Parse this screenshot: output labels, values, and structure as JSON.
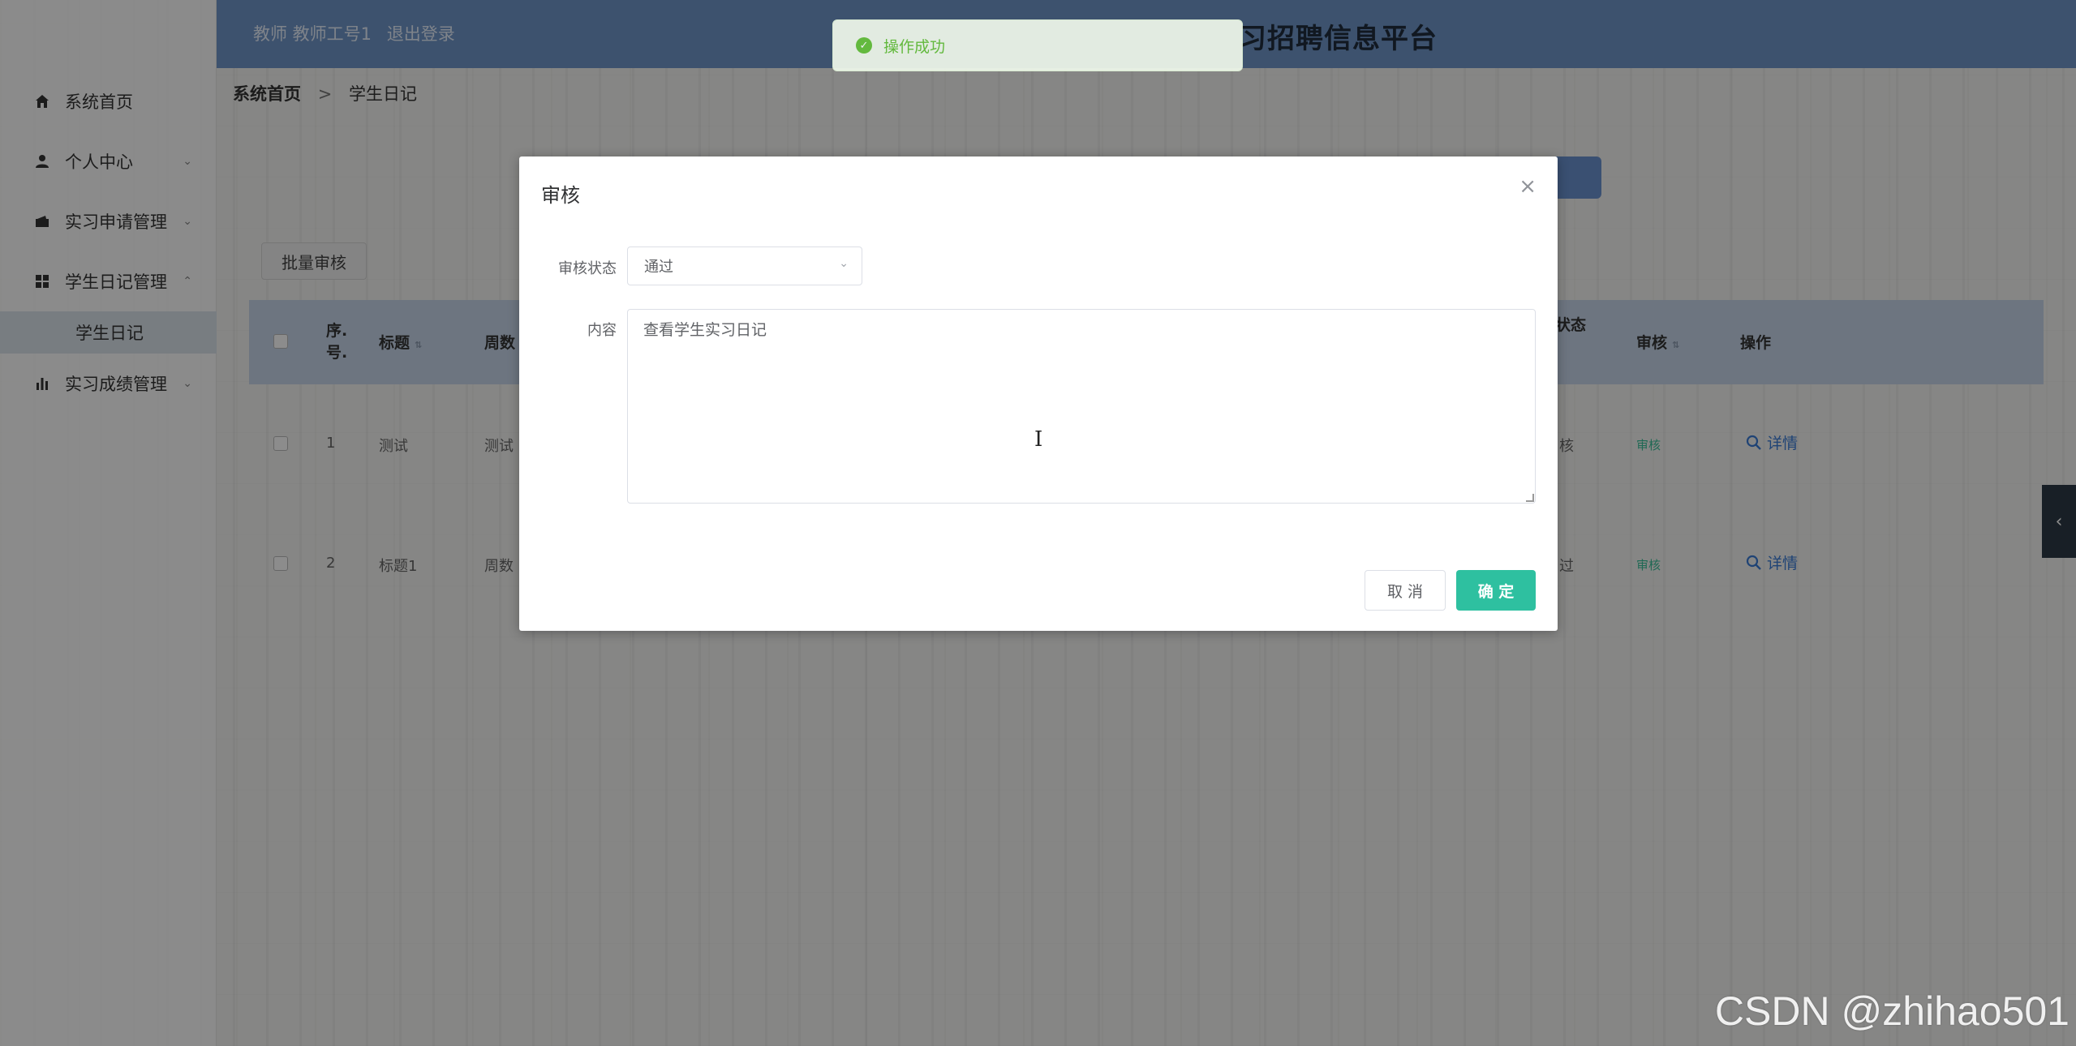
{
  "header": {
    "user_text": "教师 教师工号1",
    "logout_label": "退出登录",
    "site_title": "习招聘信息平台"
  },
  "sidebar": {
    "items": [
      {
        "label": "系统首页",
        "icon": "home-icon"
      },
      {
        "label": "个人中心",
        "icon": "user-icon"
      },
      {
        "label": "实习申请管理",
        "icon": "wallet-icon"
      },
      {
        "label": "学生日记管理",
        "icon": "grid-icon"
      },
      {
        "label": "实习成绩管理",
        "icon": "bar-chart-icon"
      }
    ],
    "sub_items": [
      {
        "label": "学生日记"
      }
    ]
  },
  "breadcrumb": {
    "home": "系统首页",
    "separator": ">",
    "current": "学生日记"
  },
  "toolbar": {
    "batch_review_label": "批量审核"
  },
  "table": {
    "headers": {
      "index": "序.\n号.",
      "title": "标题",
      "week": "周数",
      "review_status": "状态",
      "review": "审核",
      "actions": "操作"
    },
    "rows": [
      {
        "index": "1",
        "title": "测试",
        "week": "测试",
        "review_status": "核",
        "review": "审核",
        "action": "详情"
      },
      {
        "index": "2",
        "title": "标题1",
        "week": "周数",
        "review_status": "过",
        "review": "审核",
        "action": "详情"
      }
    ]
  },
  "toast": {
    "message": "操作成功",
    "color": "#67c23a"
  },
  "dialog": {
    "title": "审核",
    "status_label": "审核状态",
    "status_value": "通过",
    "content_label": "内容",
    "content_value": "查看学生实习日记",
    "cancel_label": "取 消",
    "confirm_label": "确 定",
    "confirm_color": "#2ec0a0"
  },
  "watermark": "CSDN @zhihao501"
}
